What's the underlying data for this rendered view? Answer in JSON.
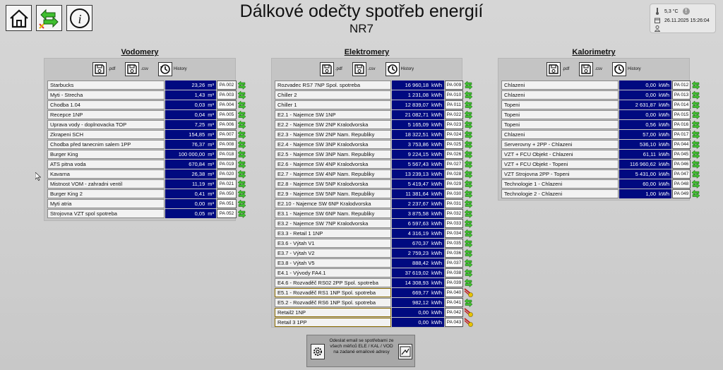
{
  "header": {
    "title": "Dálkové odečty spotřeb energií",
    "subtitle": "NR7",
    "temperature": "5,3 °C",
    "datetime": "26.11.2025 15:26:04"
  },
  "tools": {
    "pdf": ".pdf",
    "csv": ".csv",
    "history": "History"
  },
  "panels": {
    "vodomery": {
      "title": "Vodomery",
      "rows": [
        {
          "label": "Starbucks",
          "value": "23,26",
          "unit": "m³",
          "code": "PA 002",
          "status": "ok"
        },
        {
          "label": "Myti -  Strecha",
          "value": "1,43",
          "unit": "m³",
          "code": "PA 003",
          "status": "ok"
        },
        {
          "label": "Chodba 1.04",
          "value": "0,03",
          "unit": "m³",
          "code": "PA 004",
          "status": "ok"
        },
        {
          "label": "Recepce 1NP",
          "value": "0,04",
          "unit": "m³",
          "code": "PA 005",
          "status": "ok"
        },
        {
          "label": "Uprava vody - doplnovacka TOP",
          "value": "7,25",
          "unit": "m³",
          "code": "PA 006",
          "status": "ok"
        },
        {
          "label": "Zkrapeni SCH",
          "value": "154,85",
          "unit": "m³",
          "code": "PA 007",
          "status": "ok"
        },
        {
          "label": "Chodba před tanecnim salem 1PP",
          "value": "76,37",
          "unit": "m³",
          "code": "PA 008",
          "status": "ok"
        },
        {
          "label": "Burger King",
          "value": "100 000,00",
          "unit": "m³",
          "code": "PA 018",
          "status": "ok"
        },
        {
          "label": "ATS pitna voda",
          "value": "670,84",
          "unit": "m³",
          "code": "PA 019",
          "status": "ok"
        },
        {
          "label": "Kavarna",
          "value": "26,38",
          "unit": "m³",
          "code": "PA 020",
          "status": "ok"
        },
        {
          "label": "Mistnost VOM - zahradni ventil",
          "value": "11,19",
          "unit": "m³",
          "code": "PA 021",
          "status": "ok"
        },
        {
          "label": "Burger King 2",
          "value": "0,41",
          "unit": "m³",
          "code": "PA 050",
          "status": "ok"
        },
        {
          "label": "Myti atria",
          "value": "0,00",
          "unit": "m³",
          "code": "PA 051",
          "status": "ok"
        },
        {
          "label": "Strojovna VZT spol spotreba",
          "value": "0,05",
          "unit": "m³",
          "code": "PA 052",
          "status": "ok"
        }
      ]
    },
    "elektromery": {
      "title": "Elektromery",
      "rows": [
        {
          "label": "Rozvadec RS7 7NP Spol. spotreba",
          "value": "16 960,18",
          "unit": "kWh",
          "code": "PA 009",
          "status": "ok"
        },
        {
          "label": "Chiller 2",
          "value": "1 231,08",
          "unit": "kWh",
          "code": "PA 010",
          "status": "ok"
        },
        {
          "label": "Chiller 1",
          "value": "12 839,07",
          "unit": "kWh",
          "code": "PA 011",
          "status": "ok"
        },
        {
          "label": "E2.1 - Najemce SW 1NP",
          "value": "21 082,71",
          "unit": "kWh",
          "code": "PA 022",
          "status": "ok"
        },
        {
          "label": "E2.2 - Najemce SW 2NP Kralodvorska",
          "value": "5 165,09",
          "unit": "kWh",
          "code": "PA 023",
          "status": "ok"
        },
        {
          "label": "E2.3 - Najemce SW 2NP Nam. Republiky",
          "value": "18 322,51",
          "unit": "kWh",
          "code": "PA 024",
          "status": "ok"
        },
        {
          "label": "E2.4 - Najemce SW 3NP Kralodvorska",
          "value": "3 753,86",
          "unit": "kWh",
          "code": "PA 025",
          "status": "ok"
        },
        {
          "label": "E2.5 - Najemce SW 3NP Nam. Republiky",
          "value": "9 224,15",
          "unit": "kWh",
          "code": "PA 026",
          "status": "ok"
        },
        {
          "label": "E2.6 - Najemce SW 4NP Kralodvorska",
          "value": "5 567,43",
          "unit": "kWh",
          "code": "PA 027",
          "status": "ok"
        },
        {
          "label": "E2.7 - Najemce SW 4NP Nam. Republiky",
          "value": "13 239,13",
          "unit": "kWh",
          "code": "PA 028",
          "status": "ok"
        },
        {
          "label": "E2.8 - Najemce SW 5NP Kralodvorska",
          "value": "5 419,47",
          "unit": "kWh",
          "code": "PA 029",
          "status": "ok"
        },
        {
          "label": "E2.9 - Najemce SW 5NP Nam. Republiky",
          "value": "11 381,64",
          "unit": "kWh",
          "code": "PA 030",
          "status": "ok"
        },
        {
          "label": "E2.10 - Najemce SW 6NP Kralodvorska",
          "value": "2 237,67",
          "unit": "kWh",
          "code": "PA 031",
          "status": "ok"
        },
        {
          "label": "E3.1 - Najemce SW 6NP Nam. Republiky",
          "value": "3 875,58",
          "unit": "kWh",
          "code": "PA 032",
          "status": "ok"
        },
        {
          "label": "E3.2 - Najemce SW 7NP Kralodvorska",
          "value": "6 597,63",
          "unit": "kWh",
          "code": "PA 033",
          "status": "ok"
        },
        {
          "label": "E3.3 - Retail 1 1NP",
          "value": "4 316,19",
          "unit": "kWh",
          "code": "PA 034",
          "status": "ok"
        },
        {
          "label": "E3.6 - Výtah V1",
          "value": "670,37",
          "unit": "kWh",
          "code": "PA 035",
          "status": "ok"
        },
        {
          "label": "E3.7 - Výtah V2",
          "value": "2 759,23",
          "unit": "kWh",
          "code": "PA 036",
          "status": "ok"
        },
        {
          "label": "E3.8 - Výtah V5",
          "value": "888,42",
          "unit": "kWh",
          "code": "PA 037",
          "status": "ok"
        },
        {
          "label": "E4.1 - Vývody FA4.1",
          "value": "37 619,02",
          "unit": "kWh",
          "code": "PA 038",
          "status": "ok"
        },
        {
          "label": "E4.6 - Rozvaděč RS02 2PP Spol. spotreba",
          "value": "14 308,93",
          "unit": "kWh",
          "code": "PA 039",
          "status": "ok"
        },
        {
          "label": "E5.1 - Rozvaděč RS1 1NP Spol. spotreba",
          "value": "669,77",
          "unit": "kWh",
          "code": "PA 040",
          "status": "fault"
        },
        {
          "label": "E5.2 - Rozvaděč RS6 1NP Spol. spotreba",
          "value": "982,12",
          "unit": "kWh",
          "code": "PA 041",
          "status": "ok"
        },
        {
          "label": "Retail2 1NP",
          "value": "0,00",
          "unit": "kWh",
          "code": "PA 042",
          "status": "fault"
        },
        {
          "label": "Retail 3 1PP",
          "value": "0,00",
          "unit": "kWh",
          "code": "PA 043",
          "status": "fault"
        }
      ]
    },
    "kalorimetry": {
      "title": "Kalorimetry",
      "rows": [
        {
          "label": "Chlazeni",
          "value": "0,00",
          "unit": "kWh",
          "code": "PA 012",
          "status": "ok"
        },
        {
          "label": "Chlazeni",
          "value": "0,00",
          "unit": "kWh",
          "code": "PA 013",
          "status": "ok"
        },
        {
          "label": "Topeni",
          "value": "2 631,87",
          "unit": "kWh",
          "code": "PA 014",
          "status": "ok"
        },
        {
          "label": "Topeni",
          "value": "0,00",
          "unit": "kWh",
          "code": "PA 015",
          "status": "ok"
        },
        {
          "label": "Topeni",
          "value": "0,56",
          "unit": "kWh",
          "code": "PA 016",
          "status": "ok"
        },
        {
          "label": "Chlazeni",
          "value": "57,00",
          "unit": "kWh",
          "code": "PA 017",
          "status": "ok"
        },
        {
          "label": "Serverovny + 2PP - Chlazeni",
          "value": "536,10",
          "unit": "kWh",
          "code": "PA 044",
          "status": "ok"
        },
        {
          "label": "VZT + FCU Objekt - Chlazeni",
          "value": "61,11",
          "unit": "kWh",
          "code": "PA 045",
          "status": "ok"
        },
        {
          "label": "VZT + FCU Objekt - Topeni",
          "value": "116 960,62",
          "unit": "kWh",
          "code": "PA 046",
          "status": "ok"
        },
        {
          "label": "VZT Strojovna 2PP - Topeni",
          "value": "5 431,00",
          "unit": "kWh",
          "code": "PA 047",
          "status": "ok"
        },
        {
          "label": "Technologie 1 - Chlazeni",
          "value": "60,00",
          "unit": "kWh",
          "code": "PA 048",
          "status": "ok"
        },
        {
          "label": "Technologie 2 - Chlazeni",
          "value": "1,00",
          "unit": "kWh",
          "code": "PA 049",
          "status": "ok"
        }
      ]
    }
  },
  "email": {
    "text": "Odeslat email se spotřebami ze všech měřiců ELE / KAL / VOD na zadané emailové adresy"
  }
}
